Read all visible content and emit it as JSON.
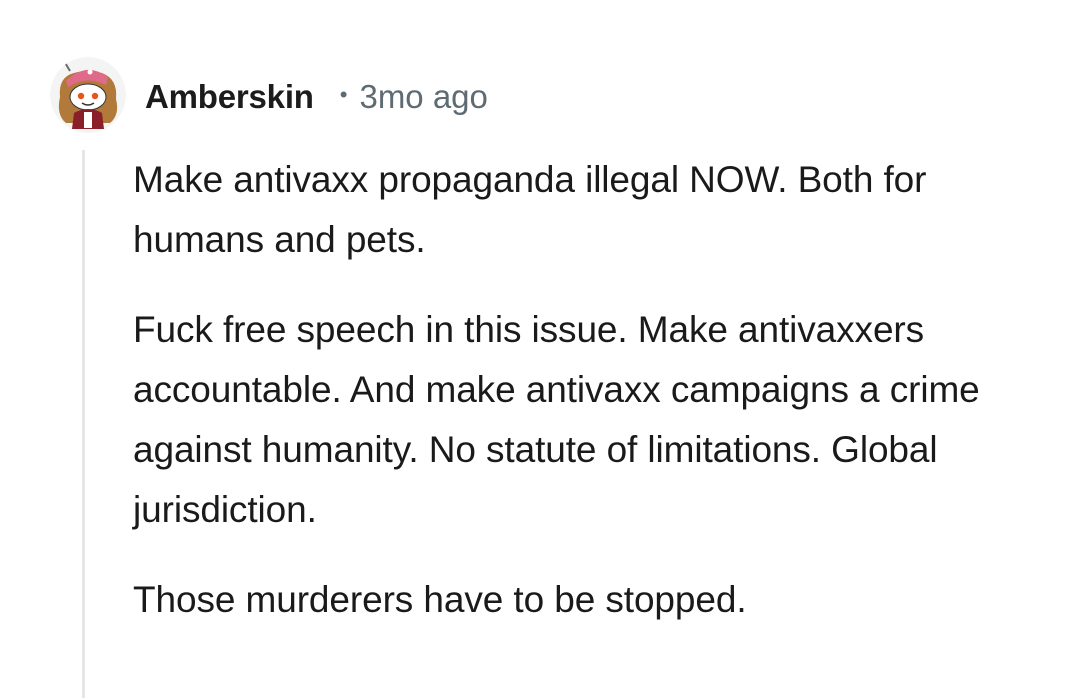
{
  "comment": {
    "avatar_icon": "snoo-avatar-icon",
    "username": "Amberskin",
    "separator": "•",
    "timestamp": "3mo ago",
    "paragraphs": [
      "Make antivaxx propaganda illegal NOW. Both for humans and pets.",
      "Fuck free speech in this issue. Make antivaxxers accountable. And make antivaxx campaigns a crime against humanity. No statute of limitations. Global jurisdiction.",
      "Those murderers have to be stopped."
    ]
  },
  "colors": {
    "text": "#1a1a1b",
    "meta": "#5f6b73",
    "thread_line": "#e4e6e8",
    "avatar_hat": "#e06a8a",
    "avatar_hair": "#b27a3a"
  }
}
